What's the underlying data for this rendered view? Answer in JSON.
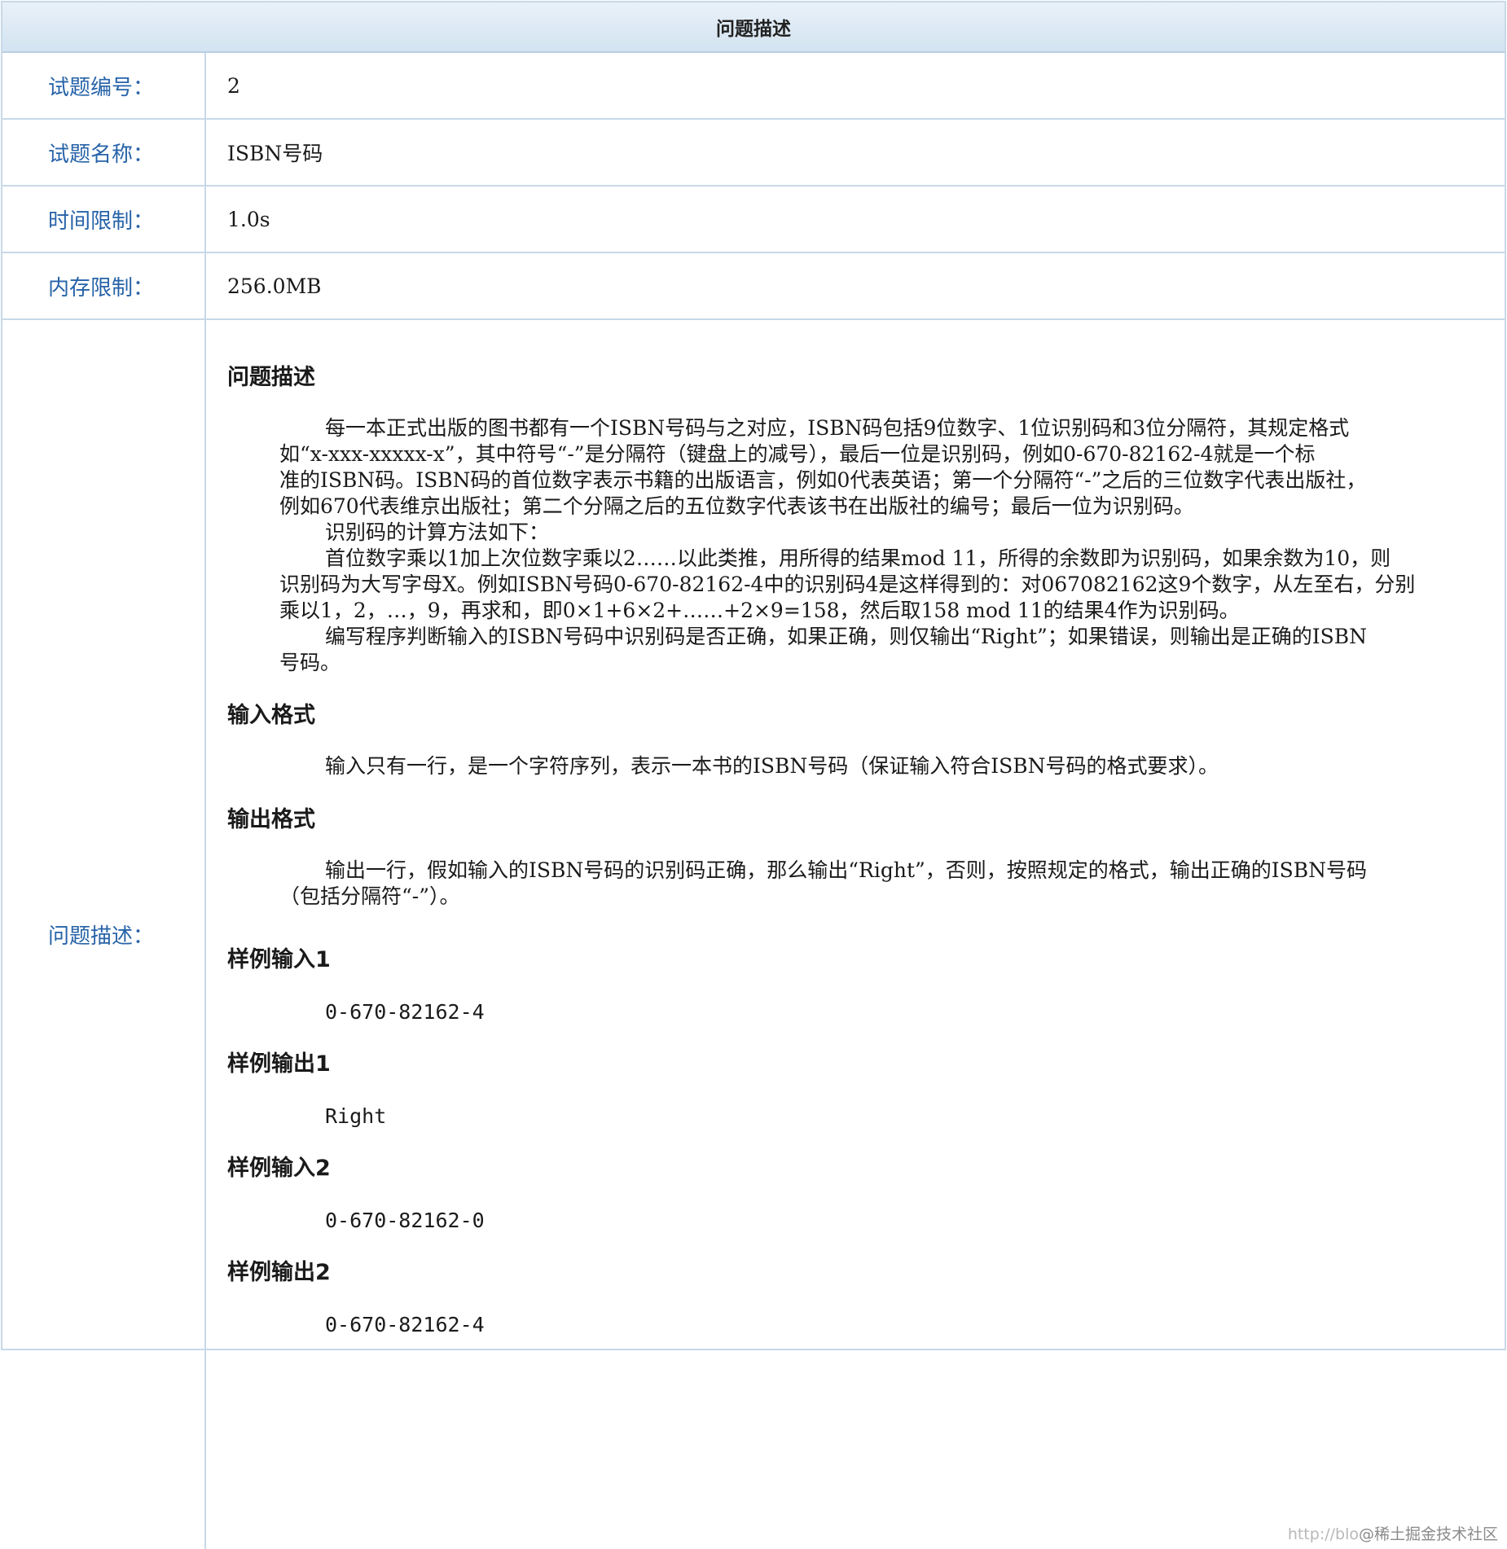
{
  "header": {
    "title": "问题描述"
  },
  "rows": {
    "id": {
      "label": "试题编号：",
      "value": "2"
    },
    "name": {
      "label": "试题名称：",
      "value": "ISBN号码"
    },
    "time": {
      "label": "时间限制：",
      "value": "1.0s"
    },
    "memory": {
      "label": "内存限制：",
      "value": "256.0MB"
    },
    "description": {
      "label": "问题描述："
    }
  },
  "description": {
    "heading": "问题描述",
    "lines": [
      "每一本正式出版的图书都有一个ISBN号码与之对应，ISBN码包括9位数字、1位识别码和3位分隔符，其规定格式",
      "如“x-xxx-xxxxx-x”，其中符号“-”是分隔符（键盘上的减号），最后一位是识别码，例如0-670-82162-4就是一个标",
      "准的ISBN码。ISBN码的首位数字表示书籍的出版语言，例如0代表英语；第一个分隔符“-”之后的三位数字代表出版社，",
      "例如670代表维京出版社；第二个分隔之后的五位数字代表该书在出版社的编号；最后一位为识别码。",
      "识别码的计算方法如下：",
      "首位数字乘以1加上次位数字乘以2……以此类推，用所得的结果mod 11，所得的余数即为识别码，如果余数为10，则",
      "识别码为大写字母X。例如ISBN号码0-670-82162-4中的识别码4是这样得到的：对067082162这9个数字，从左至右，分别",
      "乘以1，2，…，9，再求和，即0×1+6×2+……+2×9=158，然后取158 mod 11的结果4作为识别码。",
      "编写程序判断输入的ISBN号码中识别码是否正确，如果正确，则仅输出“Right”；如果错误，则输出是正确的ISBN",
      "号码。"
    ]
  },
  "input_format": {
    "heading": "输入格式",
    "text": "输入只有一行，是一个字符序列，表示一本书的ISBN号码（保证输入符合ISBN号码的格式要求）。"
  },
  "output_format": {
    "heading": "输出格式",
    "line1": "输出一行，假如输入的ISBN号码的识别码正确，那么输出“Right”，否则，按照规定的格式，输出正确的ISBN号码",
    "line2": "（包括分隔符“-”）。"
  },
  "samples": {
    "in1_heading": "样例输入1",
    "in1": "0-670-82162-4",
    "out1_heading": "样例输出1",
    "out1": "Right",
    "in2_heading": "样例输入2",
    "in2": "0-670-82162-0",
    "out2_heading": "样例输出2",
    "out2": "0-670-82162-4"
  },
  "watermark": {
    "url": "http://blo",
    "brand": "@稀土掘金技术社区"
  }
}
